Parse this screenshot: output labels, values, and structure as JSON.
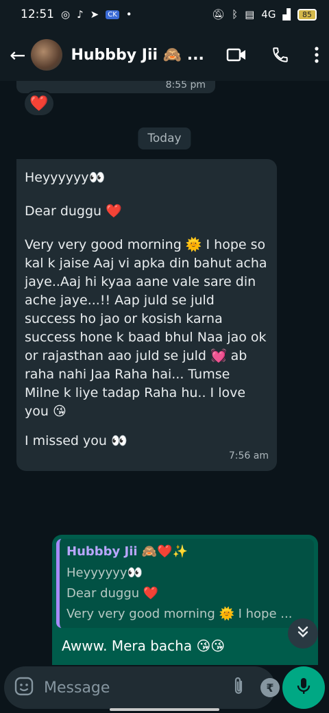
{
  "status_bar": {
    "time": "12:51",
    "ck_badge": "CK",
    "dot": "•",
    "network": "4G",
    "battery": "85"
  },
  "header": {
    "contact_name": "Hubbby Jii 🙈 ...",
    "icons": [
      "back-arrow-icon",
      "video-call-icon",
      "phone-icon",
      "more-vertical-icon"
    ]
  },
  "chat": {
    "previous_message": {
      "time": "8:55 pm",
      "reaction": "❤️"
    },
    "date_chip": "Today",
    "incoming": {
      "lines": [
        "Heyyyyyy👀",
        "Dear duggu ❤️",
        "Very very good morning 🌞 I hope so kal k jaise Aaj vi apka din bahut acha jaye..Aaj hi kyaa aane vale sare din ache jaye...!! Aap juld se juld success ho jao or kosish karna success hone k baad bhul Naa jao ok or rajasthan aao juld se juld 💓 ab raha nahi Jaa Raha hai... Tumse Milne k liye tadap Raha hu.. I love you 😘",
        "I missed you 👀"
      ],
      "time": "7:56 am"
    },
    "outgoing": {
      "quote_author": "Hubbby Jii 🙈❤️✨",
      "quote_lines": [
        "Heyyyyyy👀",
        "Dear duggu ❤️",
        "Very very good morning 🌞 I hope ..."
      ],
      "text": "Awww. Mera bacha 😘😘"
    }
  },
  "composer": {
    "placeholder": "Message",
    "rupee": "₹"
  },
  "colors": {
    "background": "#0b141a",
    "incoming_bubble": "#202c33",
    "outgoing_bubble": "#005c4b",
    "accent": "#00a884",
    "quote_bar": "#a78bfa"
  }
}
